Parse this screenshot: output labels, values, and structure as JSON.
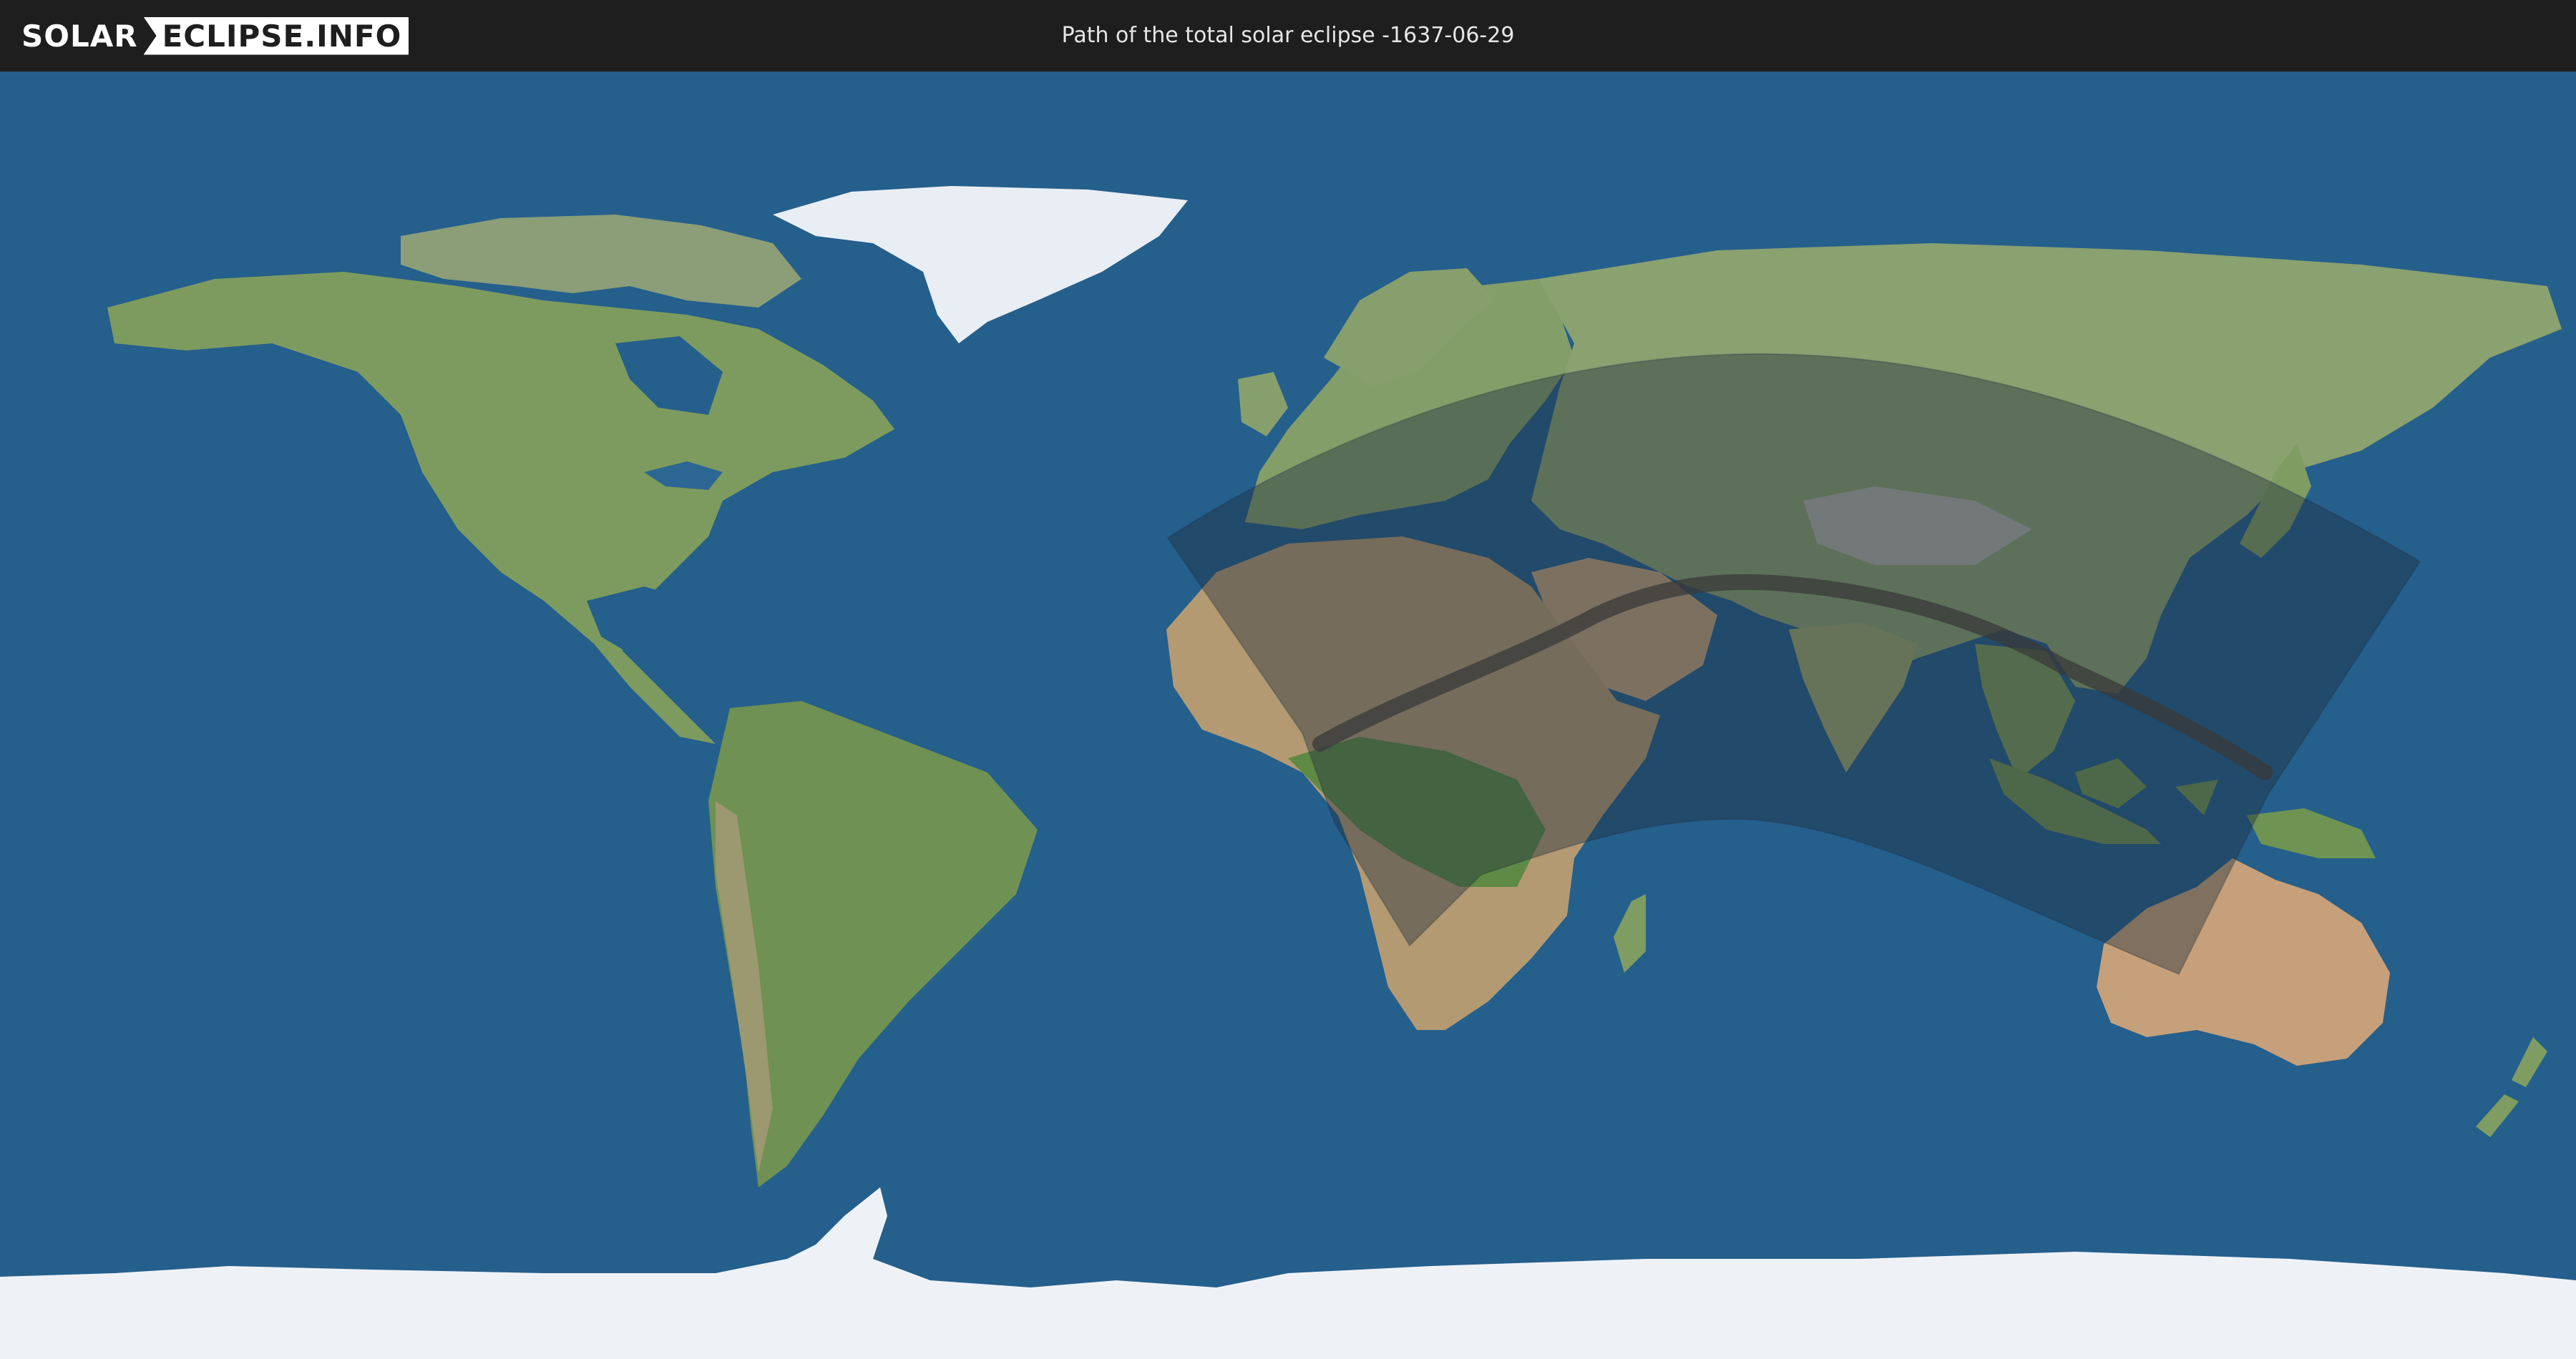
{
  "header": {
    "logo_part1": "SOLAR",
    "logo_part2": "ECLIPSE.INFO",
    "title": "Path of the total solar eclipse -1637-06-29"
  },
  "colors": {
    "ocean": "#255f8c",
    "land": "#7f9a63",
    "desert": "#b69a73",
    "ice": "#eef2f7",
    "eclipse_zone": "#1e2d3c",
    "totality_path": "#3a3a3a",
    "topbar": "#1e1e1e"
  },
  "map": {
    "projection": "equirectangular",
    "eclipse_zones": [
      "penumbral-visibility-zone",
      "total-eclipse-path"
    ]
  }
}
